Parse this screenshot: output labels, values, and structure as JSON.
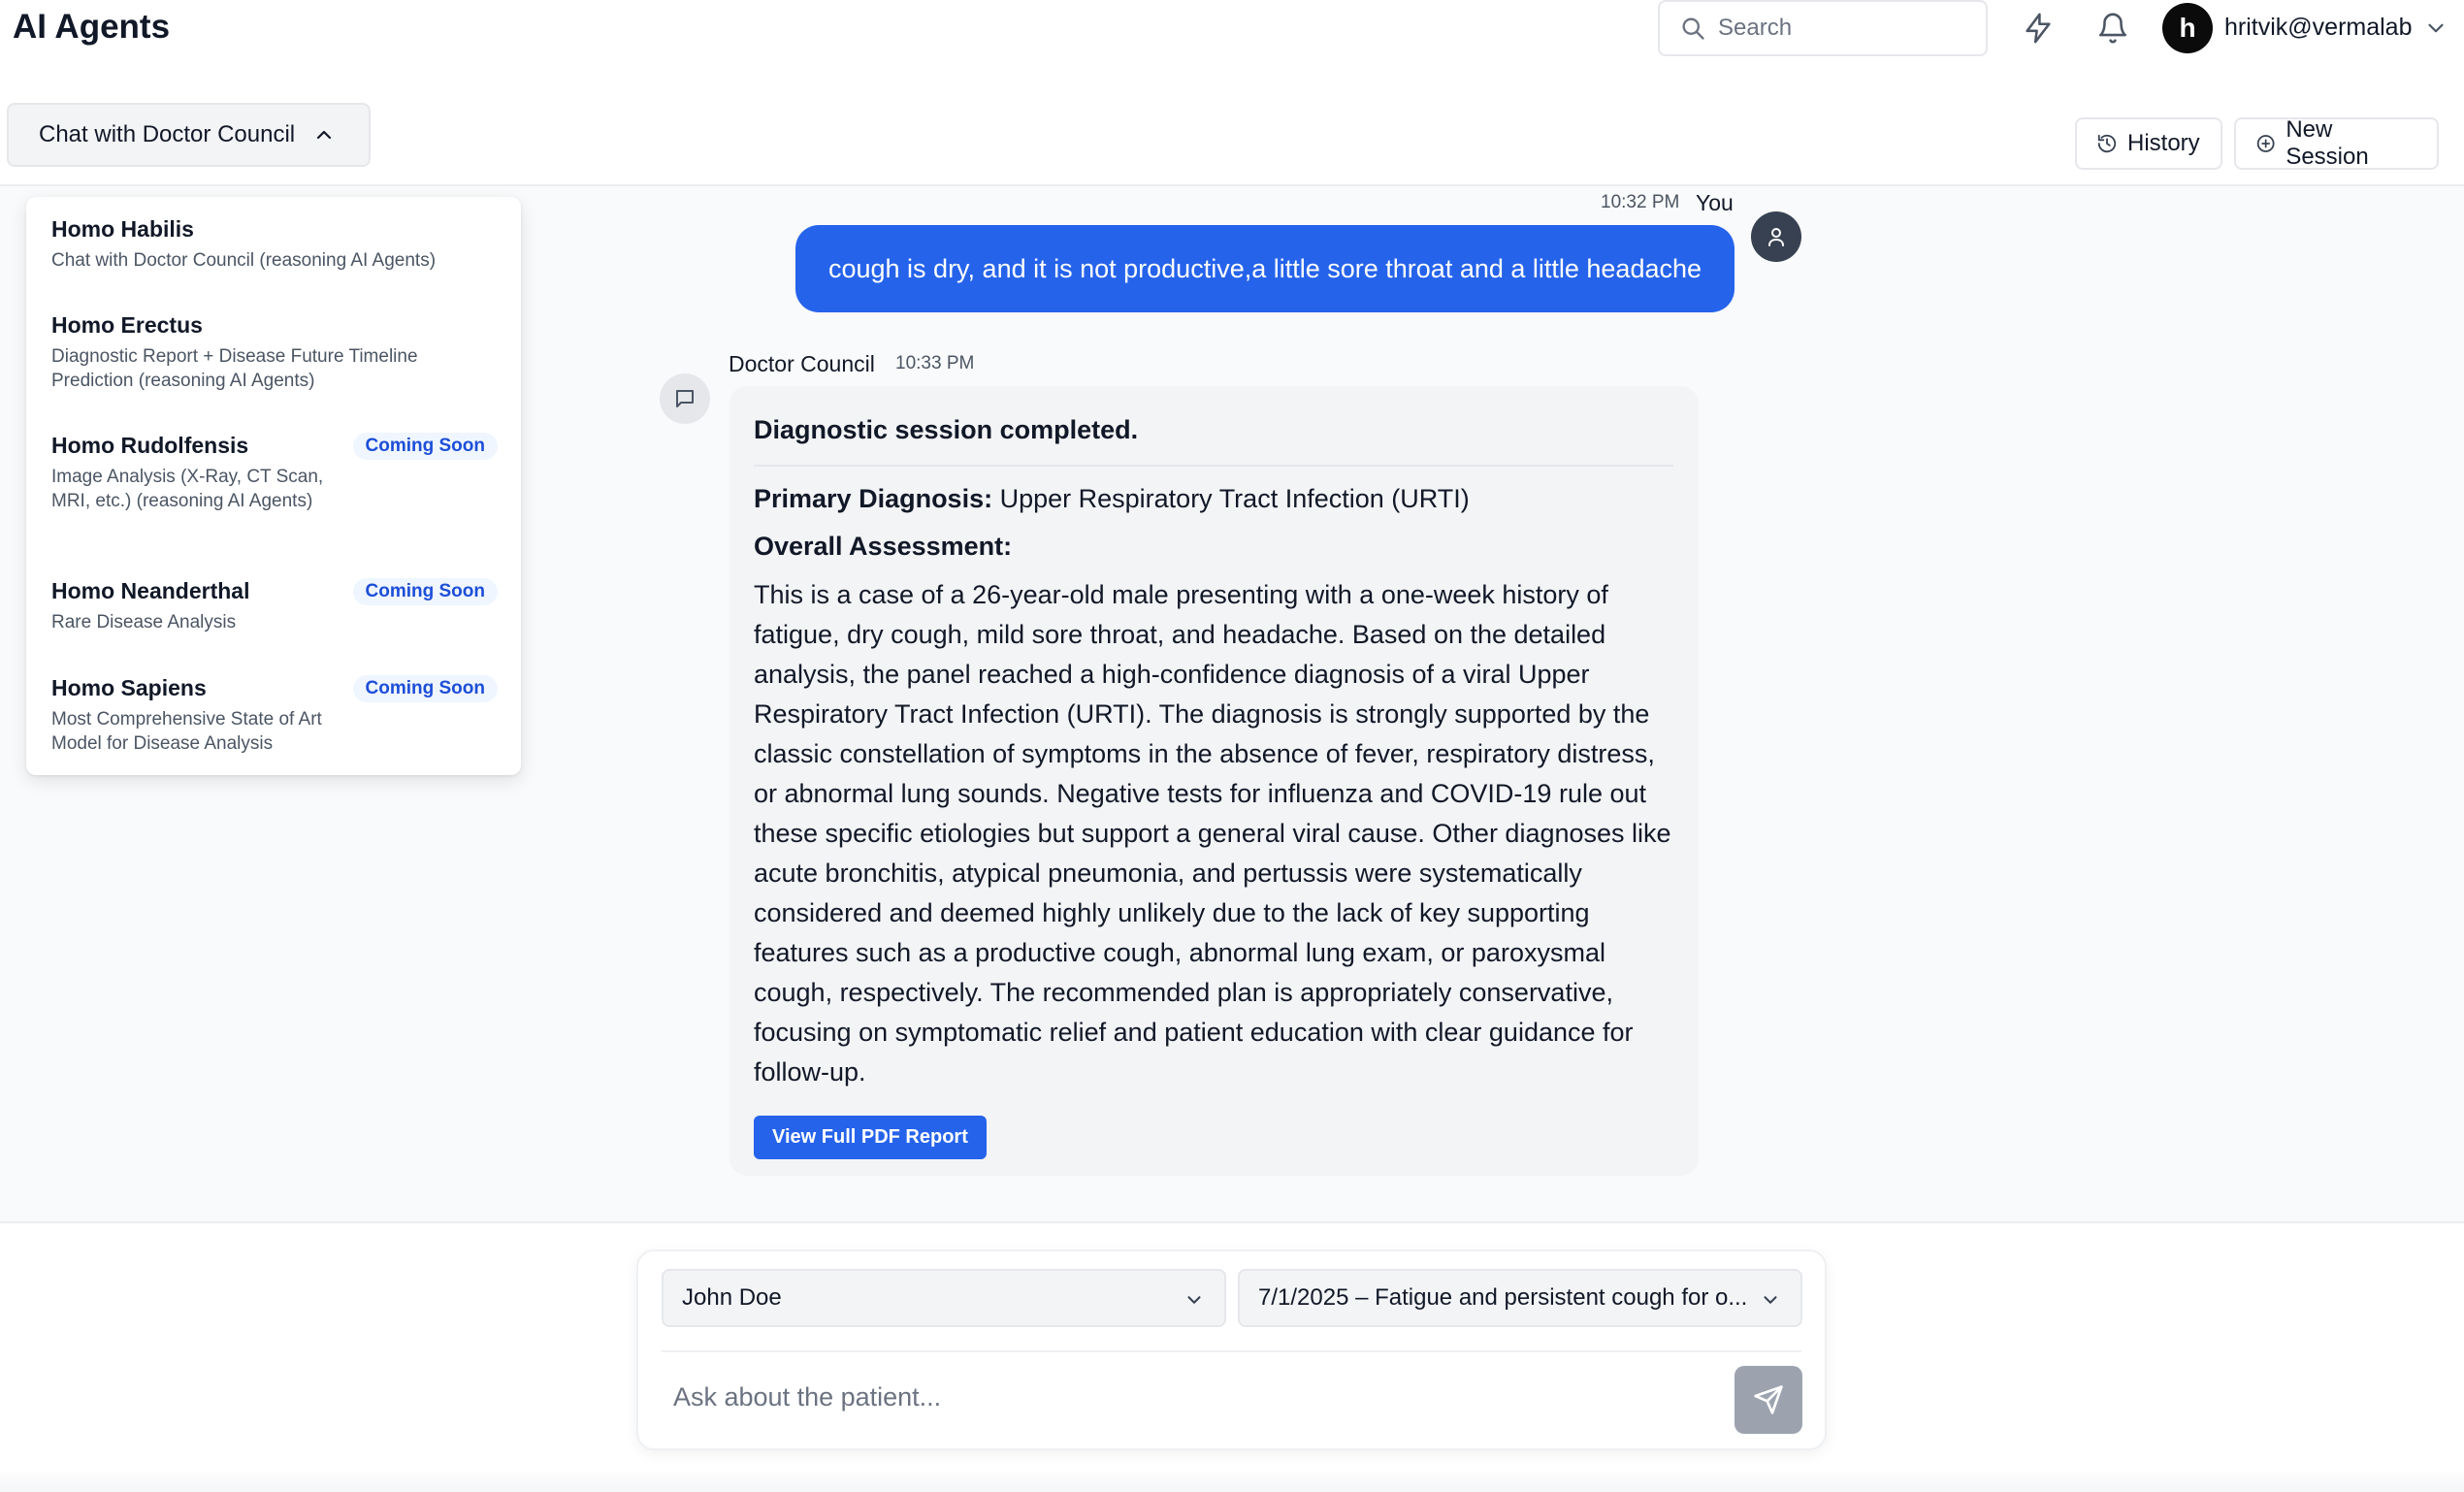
{
  "header": {
    "app_title": "AI Agents",
    "search_placeholder": "Search",
    "user_initial": "h",
    "user_name": "hritvik@vermalab"
  },
  "subheader": {
    "agent_selector_label": "Chat with Doctor Council",
    "history_label": "History",
    "new_session_label": "New Session"
  },
  "agents_dropdown": {
    "items": [
      {
        "title": "Homo Habilis",
        "description": "Chat with Doctor Council (reasoning AI Agents)",
        "badge": ""
      },
      {
        "title": "Homo Erectus",
        "description": "Diagnostic Report + Disease Future Timeline Prediction (reasoning AI Agents)",
        "badge": ""
      },
      {
        "title": "Homo Rudolfensis",
        "description": "Image Analysis (X-Ray, CT Scan, MRI, etc.) (reasoning AI Agents)",
        "badge": "Coming Soon"
      },
      {
        "title": "Homo Neanderthal",
        "description": "Rare Disease Analysis",
        "badge": "Coming Soon"
      },
      {
        "title": "Homo Sapiens",
        "description": "Most Comprehensive State of Art Model for Disease Analysis",
        "badge": "Coming Soon"
      }
    ]
  },
  "chat": {
    "user_message": {
      "time": "10:32 PM",
      "author": "You",
      "text": "cough is dry, and it is not productive,a little sore throat and a little headache"
    },
    "bot_message": {
      "author": "Doctor Council",
      "time": "10:33 PM",
      "heading": "Diagnostic session completed.",
      "primary_label": "Primary Diagnosis:",
      "primary_value": " Upper Respiratory Tract Infection (URTI)",
      "assessment_label": "Overall Assessment:",
      "assessment_text": "This is a case of a 26-year-old male presenting with a one-week history of fatigue, dry cough, mild sore throat, and headache. Based on the detailed analysis, the panel reached a high-confidence diagnosis of a viral Upper Respiratory Tract Infection (URTI). The diagnosis is strongly supported by the classic constellation of symptoms in the absence of fever, respiratory distress, or abnormal lung sounds. Negative tests for influenza and COVID-19 rule out these specific etiologies but support a general viral cause. Other diagnoses like acute bronchitis, atypical pneumonia, and pertussis were systematically considered and deemed highly unlikely due to the lack of key supporting features such as a productive cough, abnormal lung exam, or paroxysmal cough, respectively. The recommended plan is appropriately conservative, focusing on symptomatic relief and patient education with clear guidance for follow-up.",
      "pdf_button_label": "View Full PDF Report"
    }
  },
  "composer": {
    "patient_select_value": "John Doe",
    "visit_select_value": "7/1/2025 – Fatigue and persistent cough for o...",
    "input_placeholder": "Ask about the patient..."
  },
  "colors": {
    "accent": "#2563eb",
    "badge_text": "#1d4ed8",
    "badge_bg": "#eff6ff",
    "send_disabled": "#9ca3af"
  },
  "icons": [
    "search-icon",
    "bolt-icon",
    "bell-icon",
    "chevron-down-icon",
    "chevron-up-icon",
    "history-icon",
    "plus-circle-icon",
    "user-icon",
    "message-icon",
    "send-icon"
  ]
}
